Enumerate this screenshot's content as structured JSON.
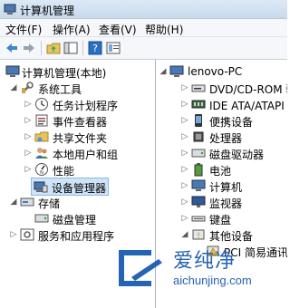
{
  "window": {
    "title": "计算机管理"
  },
  "menu": [
    "文件(F)",
    "操作(A)",
    "查看(V)",
    "帮助(H)"
  ],
  "toolbar": {
    "icons": [
      "back-icon",
      "forward-icon",
      "up-folder-icon",
      "show-hide-tree-icon",
      "help-icon",
      "properties-icon"
    ]
  },
  "left_tree": [
    {
      "label": "计算机管理(本地)"
    },
    {
      "label": "系统工具"
    },
    {
      "label": "任务计划程序"
    },
    {
      "label": "事件查看器"
    },
    {
      "label": "共享文件夹"
    },
    {
      "label": "本地用户和组"
    },
    {
      "label": "性能"
    },
    {
      "label": "设备管理器"
    },
    {
      "label": "存储"
    },
    {
      "label": "磁盘管理"
    },
    {
      "label": "服务和应用程序"
    }
  ],
  "device_tree": {
    "root": "lenovo-PC",
    "items": [
      "DVD/CD-ROM 驱",
      "IDE ATA/ATAPI 控",
      "便携设备",
      "处理器",
      "磁盘驱动器",
      "电池",
      "计算机",
      "监视器",
      "键盘",
      "其他设备",
      "PCI 简易通讯控"
    ]
  },
  "watermark": {
    "brand": "爱纯净",
    "url": "aichunjing.com"
  },
  "colors": {
    "selection": "#cfe3f8",
    "watermark": "#2563b4"
  }
}
